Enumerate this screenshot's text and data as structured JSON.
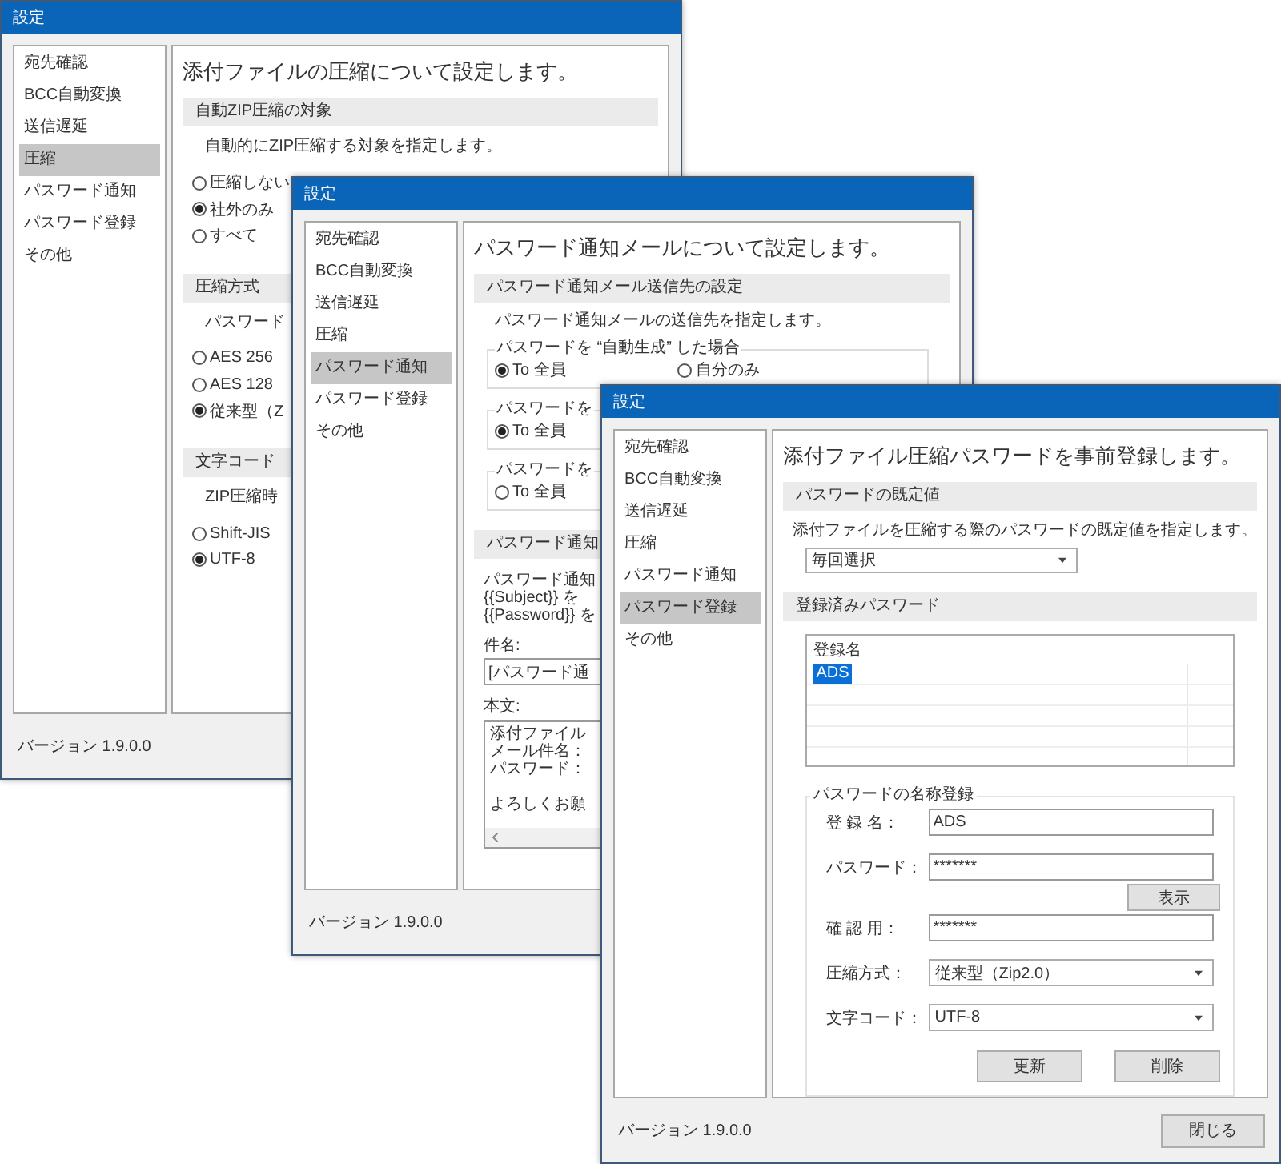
{
  "windows": [
    {
      "kind": "compression",
      "title": "設定",
      "sidebar": [
        {
          "label": "宛先確認",
          "selected": false
        },
        {
          "label": "BCC自動変換",
          "selected": false
        },
        {
          "label": "送信遅延",
          "selected": false
        },
        {
          "label": "圧縮",
          "selected": true
        },
        {
          "label": "パスワード通知",
          "selected": false
        },
        {
          "label": "パスワード登録",
          "selected": false
        },
        {
          "label": "その他",
          "selected": false
        }
      ],
      "heading": "添付ファイルの圧縮について設定します。",
      "sections": [
        {
          "title": "自動ZIP圧縮の対象",
          "description": "自動的にZIP圧縮する対象を指定します。",
          "options": [
            {
              "label": "圧縮しない",
              "selected": false
            },
            {
              "label": "社外のみ",
              "selected": true
            },
            {
              "label": "すべて",
              "selected": false
            }
          ]
        },
        {
          "title": "圧縮方式",
          "description": "パスワード",
          "options": [
            {
              "label": "AES 256",
              "selected": false
            },
            {
              "label": "AES 128",
              "selected": false
            },
            {
              "label": "従来型（Z",
              "selected": true
            }
          ]
        },
        {
          "title": "文字コード",
          "description": "ZIP圧縮時",
          "options": [
            {
              "label": "Shift-JIS",
              "selected": false
            },
            {
              "label": "UTF-8",
              "selected": true
            }
          ]
        }
      ],
      "version": "バージョン 1.9.0.0"
    },
    {
      "kind": "notification",
      "title": "設定",
      "sidebar": [
        {
          "label": "宛先確認",
          "selected": false
        },
        {
          "label": "BCC自動変換",
          "selected": false
        },
        {
          "label": "送信遅延",
          "selected": false
        },
        {
          "label": "圧縮",
          "selected": false
        },
        {
          "label": "パスワード通知",
          "selected": true
        },
        {
          "label": "パスワード登録",
          "selected": false
        },
        {
          "label": "その他",
          "selected": false
        }
      ],
      "heading": "パスワード通知メールについて設定します。",
      "recipients": {
        "title": "パスワード通知メール送信先の設定",
        "description": "パスワード通知メールの送信先を指定します。",
        "groups": [
          {
            "label": "パスワードを “自動生成” した場合",
            "options": [
              {
                "label": "To 全員",
                "selected": true
              },
              {
                "label": "自分のみ",
                "selected": false
              }
            ]
          },
          {
            "label": "パスワードを",
            "options": [
              {
                "label": "To 全員",
                "selected": true
              }
            ]
          },
          {
            "label": "パスワードを",
            "options": [
              {
                "label": "To 全員",
                "selected": false
              }
            ]
          }
        ]
      },
      "mail": {
        "title": "パスワード通知",
        "description_lines": [
          "パスワード通知",
          "{{Subject}} を",
          "{{Password}} を"
        ],
        "subject_label": "件名:",
        "subject_value": "[パスワード通",
        "body_label": "本文:",
        "body_paragraphs": [
          {
            "lines": [
              "添付ファイル",
              "メール件名：",
              "パスワード："
            ]
          },
          {
            "lines": [
              "よろしくお願"
            ]
          }
        ]
      },
      "version": "バージョン 1.9.0.0"
    },
    {
      "kind": "registration",
      "title": "設定",
      "sidebar": [
        {
          "label": "宛先確認",
          "selected": false
        },
        {
          "label": "BCC自動変換",
          "selected": false
        },
        {
          "label": "送信遅延",
          "selected": false
        },
        {
          "label": "圧縮",
          "selected": false
        },
        {
          "label": "パスワード通知",
          "selected": false
        },
        {
          "label": "パスワード登録",
          "selected": true
        },
        {
          "label": "その他",
          "selected": false
        }
      ],
      "heading": "添付ファイル圧縮パスワードを事前登録します。",
      "default": {
        "title": "パスワードの既定値",
        "description": "添付ファイルを圧縮する際のパスワードの既定値を指定します。",
        "select": "毎回選択"
      },
      "registered": {
        "title": "登録済みパスワード",
        "column": "登録名",
        "rows": [
          {
            "name": "ADS",
            "selected": true
          }
        ]
      },
      "form": {
        "label": "パスワードの名称登録",
        "fields": [
          {
            "kind": "text",
            "label": "登 録 名：",
            "value": "ADS"
          },
          {
            "kind": "text",
            "label": "パスワード：",
            "value": "*******"
          },
          {
            "kind": "button",
            "label": "表示"
          },
          {
            "kind": "text",
            "label": "確 認 用：",
            "value": "*******"
          },
          {
            "kind": "select",
            "label": "圧縮方式：",
            "value": "従来型（Zip2.0）"
          },
          {
            "kind": "select",
            "label": "文字コード：",
            "value": "UTF-8"
          }
        ],
        "buttons": [
          "更新",
          "削除"
        ]
      },
      "version": "バージョン 1.9.0.0",
      "close_button": "閉じる"
    }
  ]
}
